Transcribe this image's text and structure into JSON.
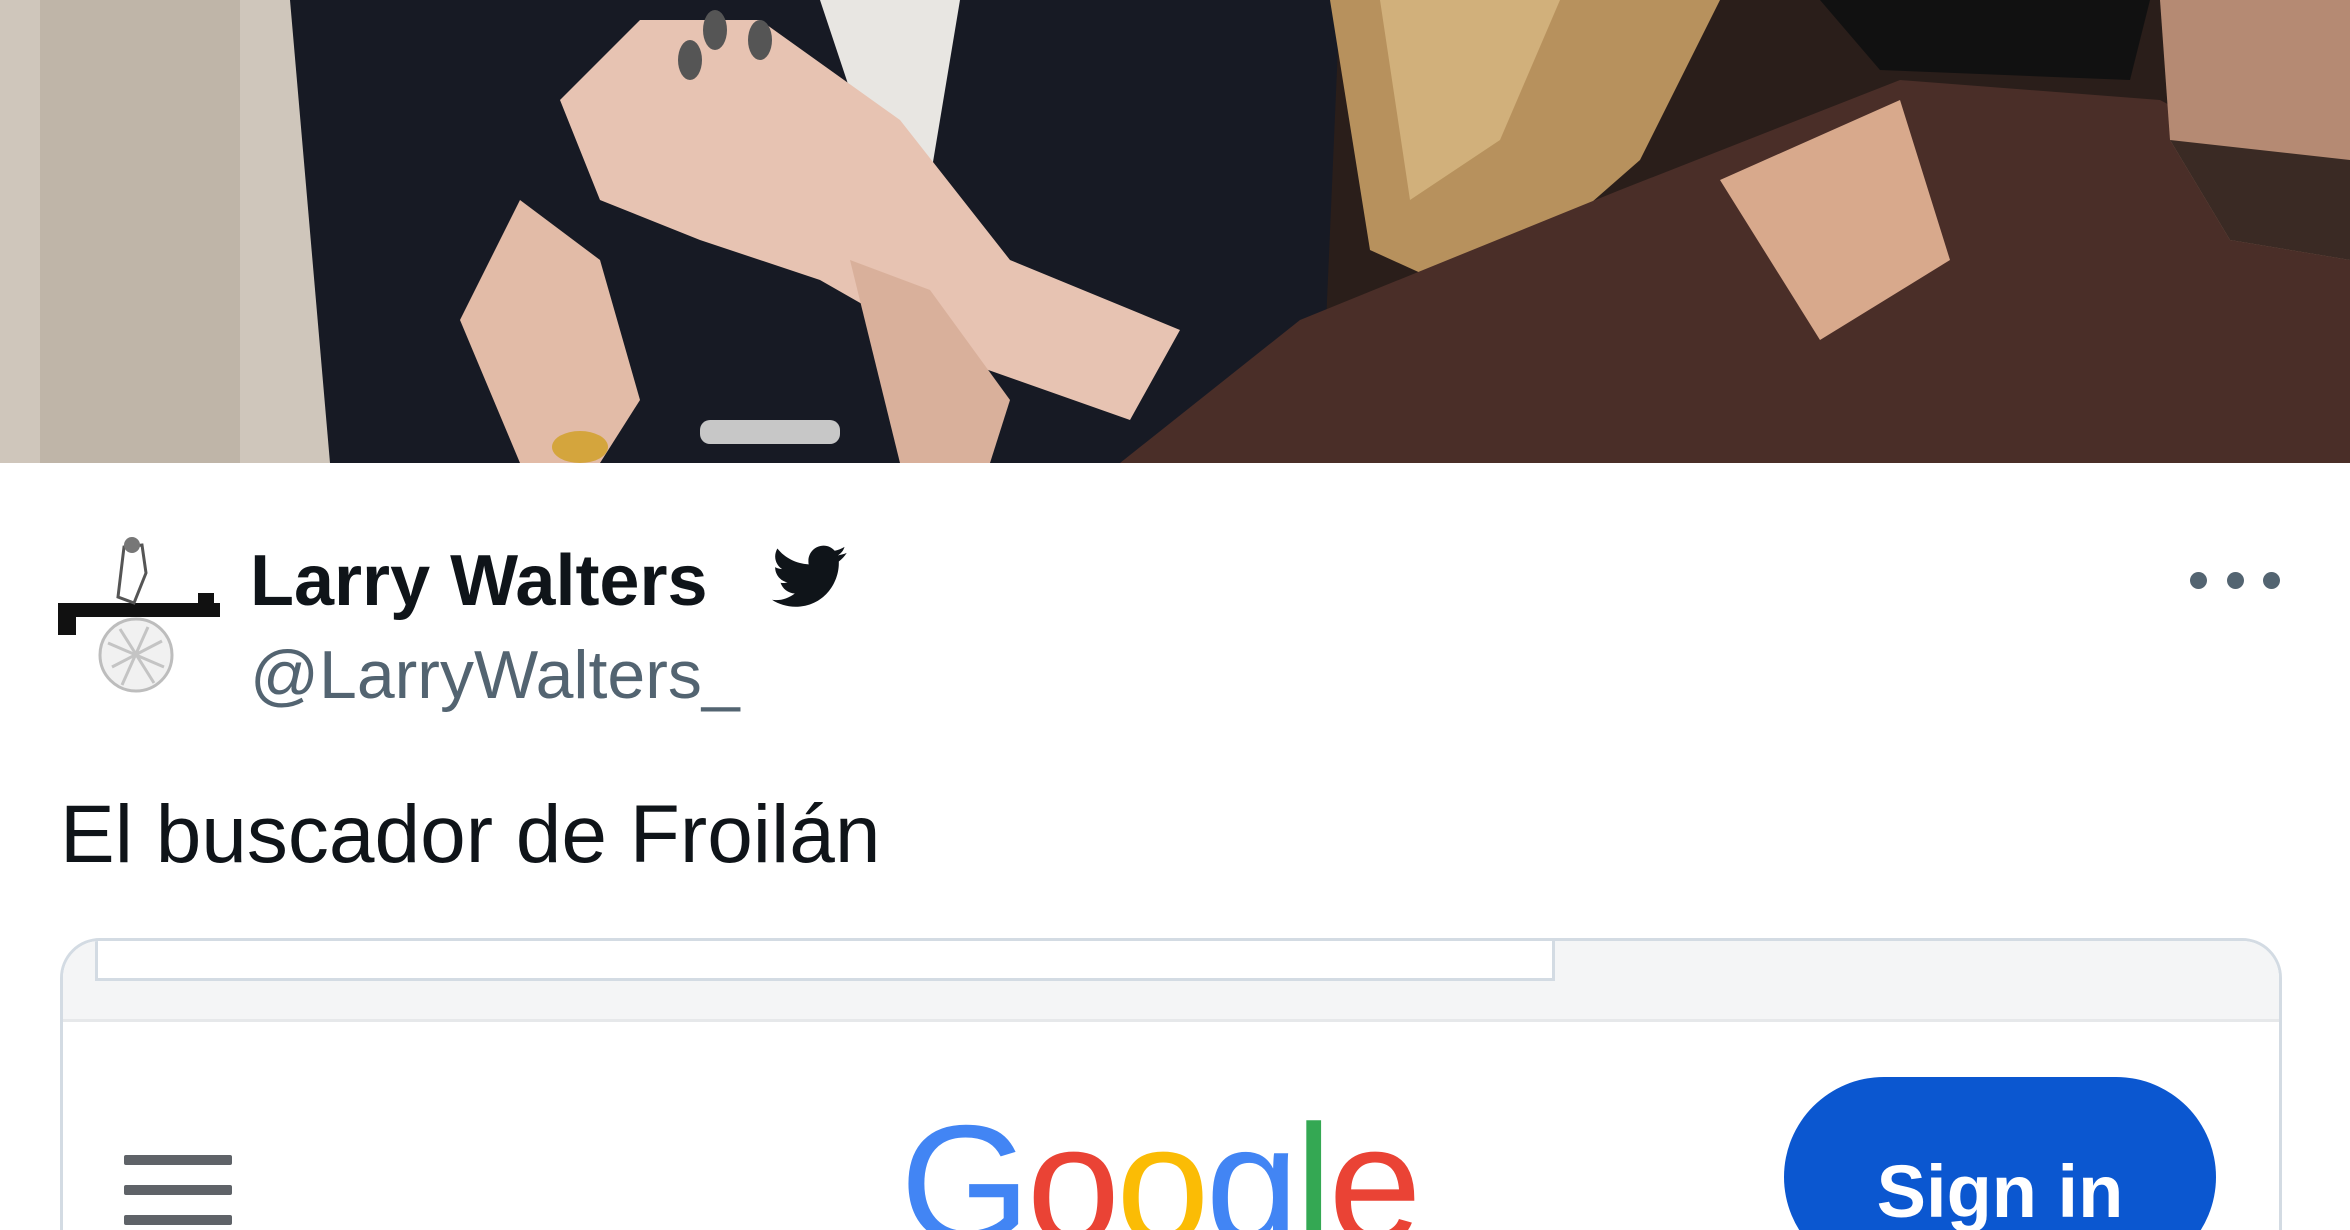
{
  "tweet": {
    "author_name": "Larry Walters",
    "handle": "@LarryWalters_",
    "text": "El buscador de Froilán"
  },
  "embedded_screenshot": {
    "logo_text": "Google",
    "logo_colors": [
      "#4285f4",
      "#ea4335",
      "#fbbc05",
      "#4285f4",
      "#34a853",
      "#ea4335"
    ],
    "signin_label": "Sign in"
  },
  "colors": {
    "twitter_blue": "#0f1419",
    "google_button": "#0b57d0",
    "secondary_text": "#536471"
  },
  "icons": {
    "verified": "twitter-bird-icon",
    "more": "more-icon",
    "menu": "hamburger-menu-icon"
  }
}
